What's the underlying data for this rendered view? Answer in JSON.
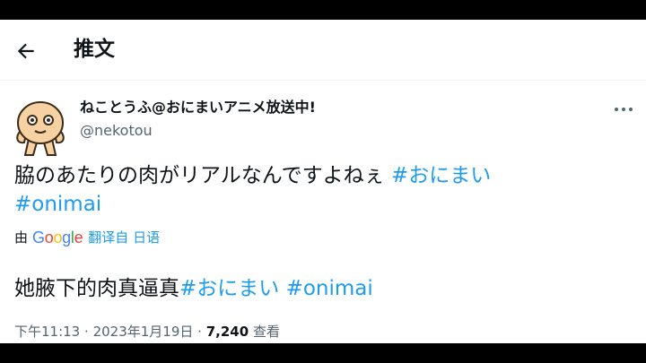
{
  "header": {
    "title": "推文",
    "back_icon": "arrow-left-icon"
  },
  "author": {
    "display_name": "ねことうふ@おにまいアニメ放送中!",
    "handle": "@nekotou",
    "avatar_icon": "tofu-cat-avatar",
    "more_icon": "more-horizontal-icon"
  },
  "tweet": {
    "text": "脇のあたりの肉がリアルなんですよねぇ ",
    "hashtag1": "#おにまい",
    "hashtag2": "#onimai"
  },
  "translation": {
    "by_label": "由",
    "google_logo_text": "Google",
    "source_label": "翻译自 日语",
    "text": "她腋下的肉真逼真",
    "hashtag1": "#おにまい",
    "hashtag2": "#onimai"
  },
  "meta": {
    "time": "下午11:13",
    "date": "2023年1月19日",
    "views_count": "7,240",
    "views_label": "查看",
    "separator": "·"
  },
  "colors": {
    "link": "#1d9bf0",
    "secondary_text": "#536471",
    "primary_text": "#0f1419",
    "google_blue": "#4285f4",
    "google_red": "#ea4335",
    "google_yellow": "#fbbc05",
    "google_green": "#34a853"
  }
}
